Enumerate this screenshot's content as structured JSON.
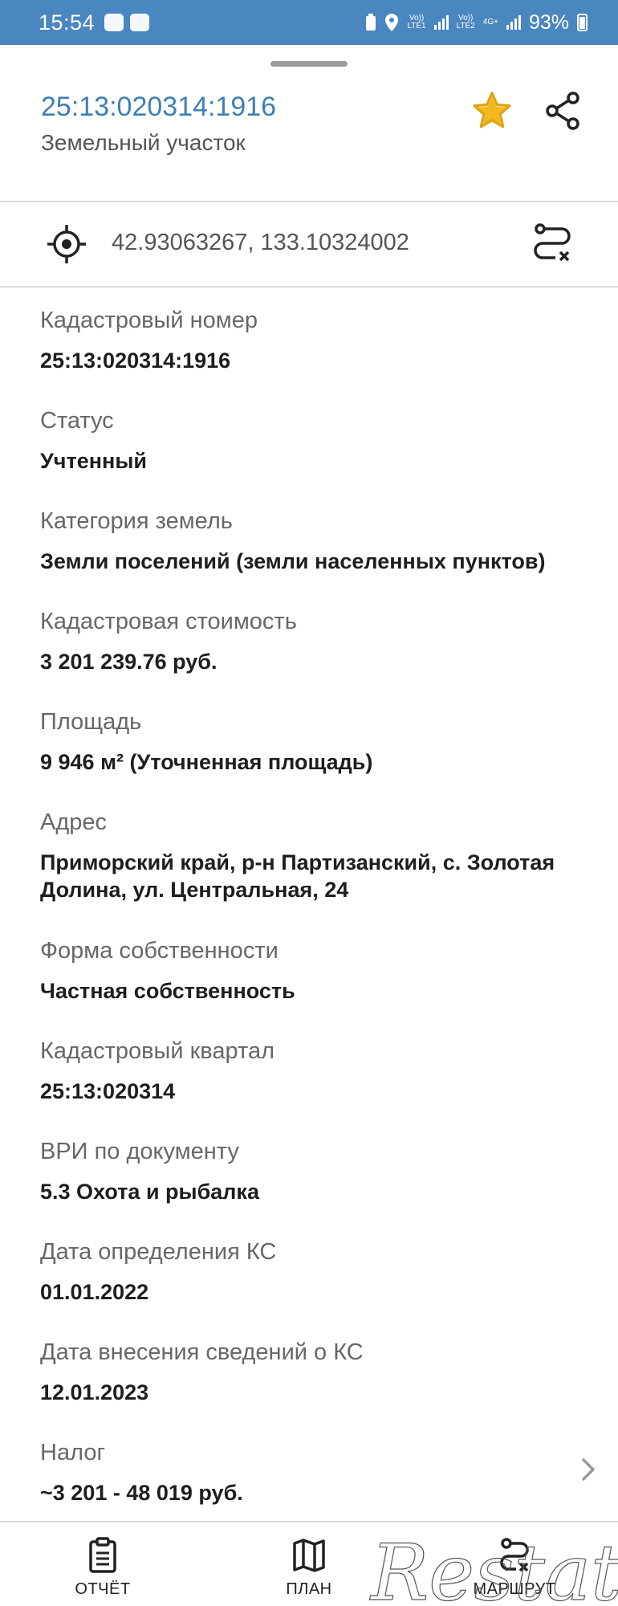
{
  "status_bar": {
    "time": "15:54",
    "net1_top": "Vo))",
    "net1_bottom": "LTE1",
    "net2_top": "Vo))",
    "net2_bottom": "LTE2",
    "net2_tag": "4G+",
    "battery": "93%"
  },
  "header": {
    "title": "25:13:020314:1916",
    "subtitle": "Земельный участок",
    "star_color": "#f2b81c"
  },
  "coordinates": "42.93063267, 133.10324002",
  "fields": [
    {
      "label": "Кадастровый номер",
      "value": "25:13:020314:1916"
    },
    {
      "label": "Статус",
      "value": "Учтенный"
    },
    {
      "label": "Категория земель",
      "value": "Земли поселений (земли населенных пунктов)"
    },
    {
      "label": "Кадастровая стоимость",
      "value": "3 201 239.76 руб."
    },
    {
      "label": "Площадь",
      "value": "9 946 м² (Уточненная площадь)"
    },
    {
      "label": "Адрес",
      "value": "Приморский край, р-н Партизанский, с. Золотая Долина, ул. Центральная, 24"
    },
    {
      "label": "Форма собственности",
      "value": "Частная собственность"
    },
    {
      "label": "Кадастровый квартал",
      "value": "25:13:020314"
    },
    {
      "label": "ВРИ по документу",
      "value": "5.3 Охота и рыбалка"
    },
    {
      "label": "Дата определения КС",
      "value": "01.01.2022"
    },
    {
      "label": "Дата внесения сведений о КС",
      "value": "12.01.2023"
    },
    {
      "label": "Налог",
      "value": "~3 201 - 48 019 руб."
    }
  ],
  "bottom_nav": {
    "report": "ОТЧЁТ",
    "plan": "ПЛАН",
    "route": "МАРШРУТ"
  },
  "watermark": "Restate"
}
